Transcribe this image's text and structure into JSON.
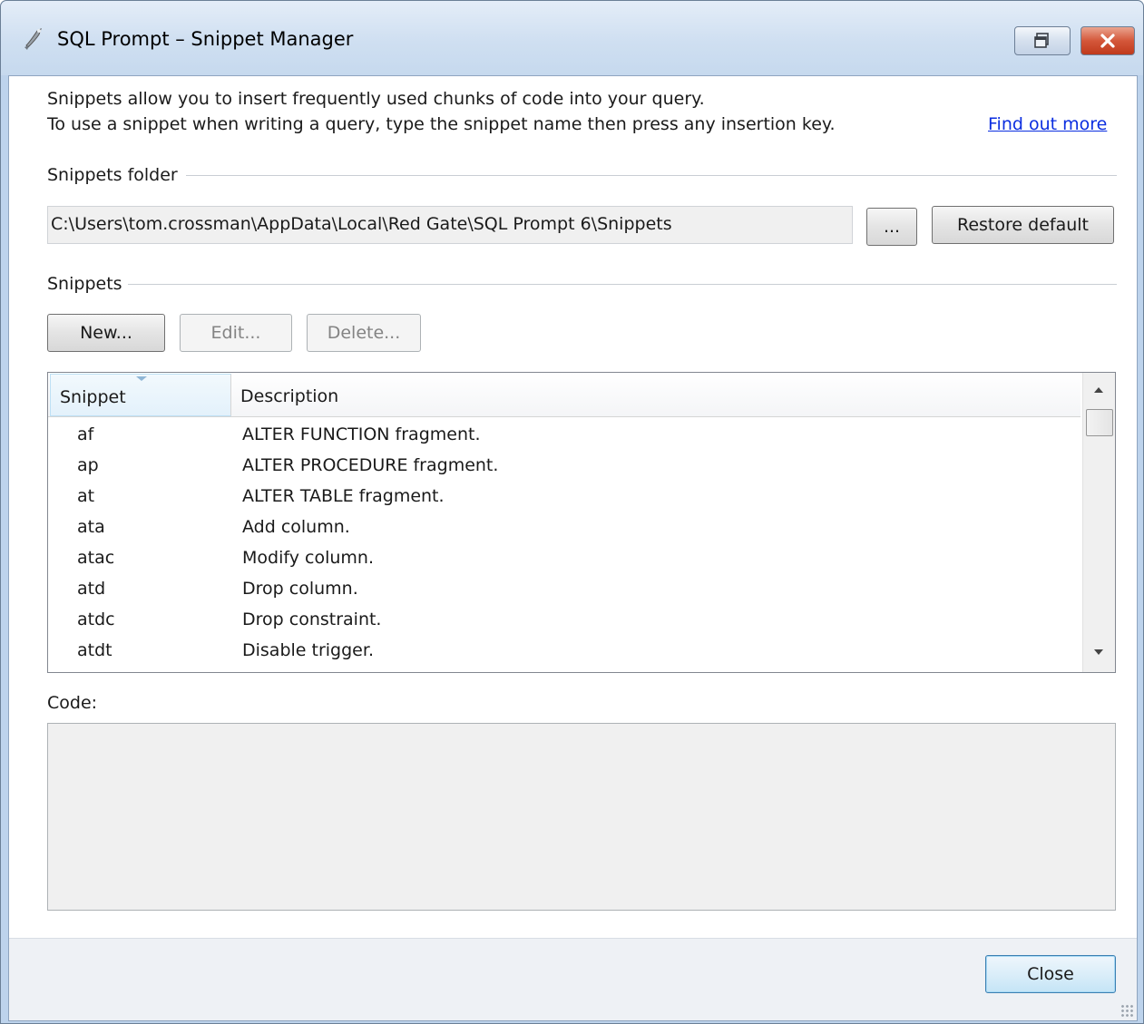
{
  "window": {
    "title": "SQL Prompt – Snippet Manager"
  },
  "intro": {
    "line1": "Snippets allow you to insert frequently used chunks of code into your query.",
    "line2": "To use a snippet when writing a query, type the snippet name then press any insertion key.",
    "link": "Find out more"
  },
  "folder": {
    "label": "Snippets folder",
    "path": "C:\\Users\\tom.crossman\\AppData\\Local\\Red Gate\\SQL Prompt 6\\Snippets",
    "browse_label": "...",
    "restore_label": "Restore default"
  },
  "snippets": {
    "label": "Snippets",
    "new_label": "New...",
    "edit_label": "Edit...",
    "delete_label": "Delete...",
    "columns": {
      "snippet": "Snippet",
      "description": "Description"
    },
    "rows": [
      {
        "name": "af",
        "description": "ALTER FUNCTION fragment."
      },
      {
        "name": "ap",
        "description": "ALTER PROCEDURE fragment."
      },
      {
        "name": "at",
        "description": "ALTER TABLE fragment."
      },
      {
        "name": "ata",
        "description": "Add column."
      },
      {
        "name": "atac",
        "description": "Modify column."
      },
      {
        "name": "atd",
        "description": "Drop column."
      },
      {
        "name": "atdc",
        "description": "Drop constraint."
      },
      {
        "name": "atdt",
        "description": "Disable trigger."
      }
    ]
  },
  "code": {
    "label": "Code:",
    "value": ""
  },
  "footer": {
    "close_label": "Close"
  },
  "colors": {
    "link": "#0b2ee0",
    "titlebar": "#cfdff1",
    "close_button": "#d4573a",
    "footer": "#eef1f5"
  },
  "icons": {
    "title": "sql-prompt-app-icon",
    "restore": "restore-window-icon",
    "close": "close-x-icon",
    "sort": "sort-indicator-icon",
    "scroll_up": "scroll-up-arrow-icon",
    "scroll_down": "scroll-down-arrow-icon",
    "grip": "resize-grip-icon"
  }
}
